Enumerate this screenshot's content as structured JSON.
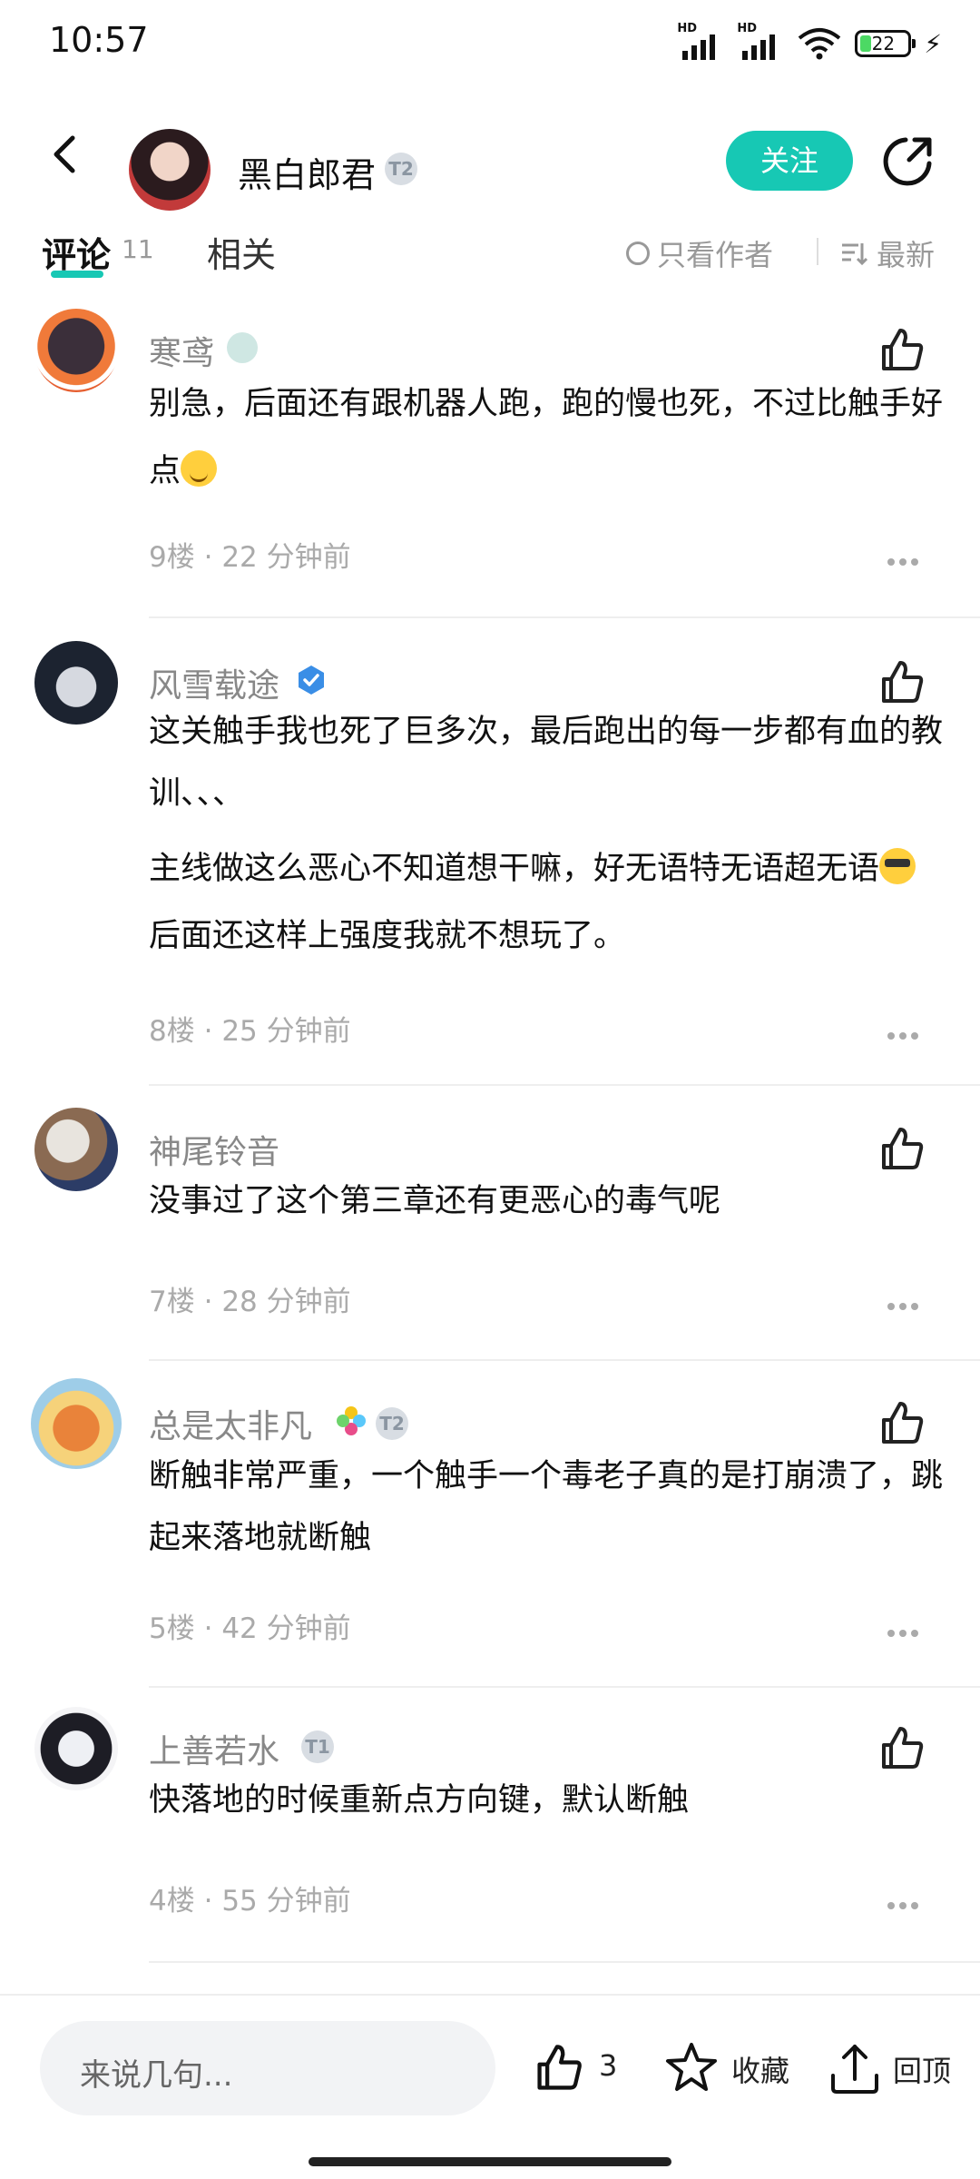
{
  "status_bar": {
    "time": "10:57",
    "network_1": "HD",
    "network_2": "HD",
    "battery": "22",
    "icons": [
      "signal-icon",
      "signal-icon",
      "wifi-icon",
      "battery-icon",
      "charging-icon"
    ]
  },
  "header": {
    "author_name": "黑白郎君",
    "author_level": "T2",
    "follow_label": "关注",
    "accent_color": "#17c8b4"
  },
  "tabs": {
    "comments_label": "评论",
    "comments_count": "11",
    "related_label": "相关",
    "only_author_label": "只看作者",
    "sort_label": "最新"
  },
  "comments": [
    {
      "name": "寒鸢",
      "text": [
        "别急，后面还有跟机器人跑，跑的慢也死，不过比触手好点"
      ],
      "floor": "9楼",
      "time": "22 分钟前"
    },
    {
      "name": "风雪载途",
      "text": [
        "这关触手我也死了巨多次，最后跑出的每一步都有血的教训、、、",
        "主线做这么恶心不知道想干嘛，好无语特无语超无语",
        "后面还这样上强度我就不想玩了。"
      ],
      "floor": "8楼",
      "time": "25 分钟前"
    },
    {
      "name": "神尾铃音",
      "text": [
        "没事过了这个第三章还有更恶心的毒气呢"
      ],
      "floor": "7楼",
      "time": "28 分钟前"
    },
    {
      "name": "总是太非凡",
      "text": [
        "断触非常严重，一个触手一个毒老子真的是打崩溃了，跳起来落地就断触"
      ],
      "floor": "5楼",
      "time": "42 分钟前",
      "level": "T2"
    },
    {
      "name": "上善若水",
      "text": [
        "快落地的时候重新点方向键，默认断触"
      ],
      "floor": "4楼",
      "time": "55 分钟前",
      "level": "T1"
    }
  ],
  "meta_separator": "·",
  "bottom_bar": {
    "input_placeholder": "来说几句...",
    "like_count": "3",
    "favorite_label": "收藏",
    "top_label": "回顶"
  }
}
